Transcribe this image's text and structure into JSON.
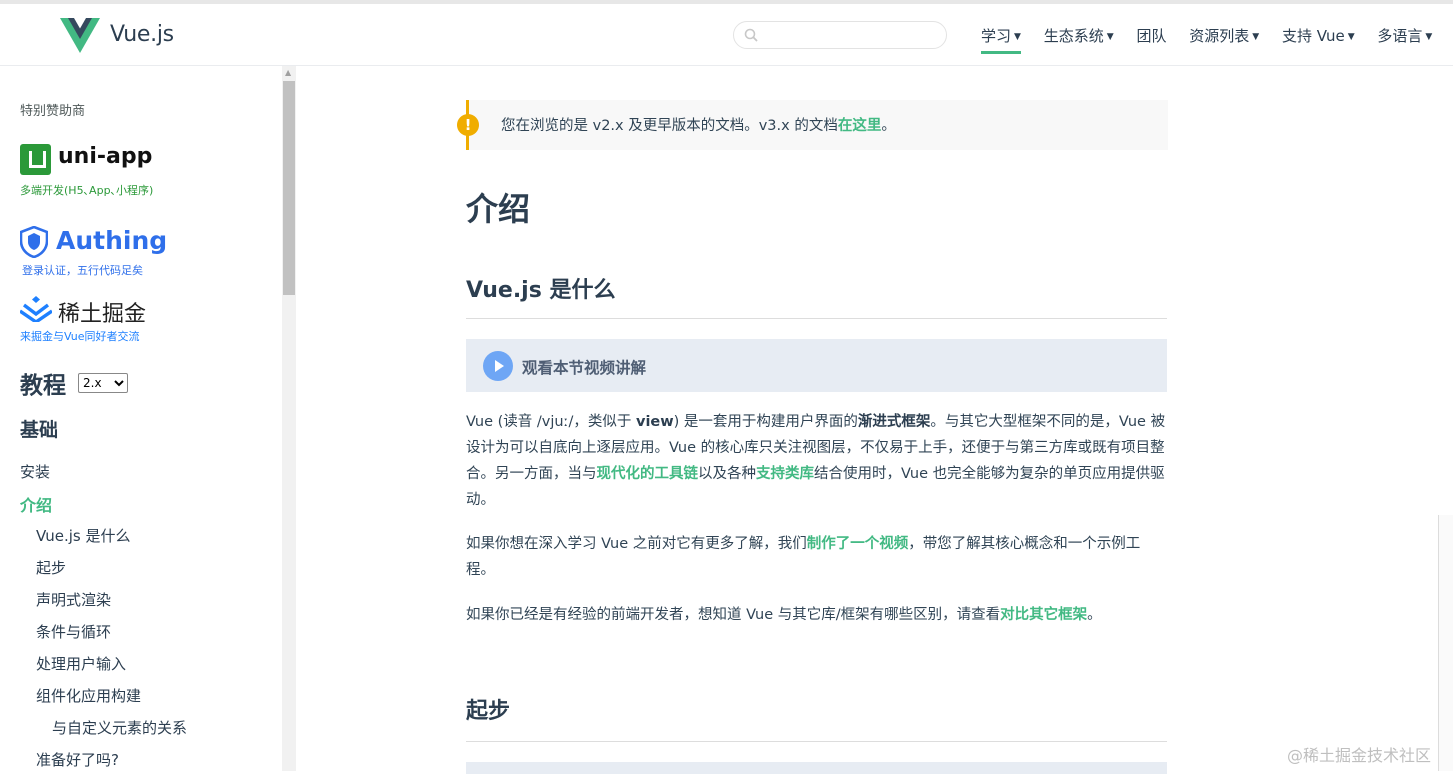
{
  "header": {
    "brand": "Vue.js",
    "search": {
      "value": "",
      "placeholder": ""
    },
    "nav": [
      {
        "label": "学习",
        "caret": "▼"
      },
      {
        "label": "生态系统",
        "caret": "▼"
      },
      {
        "label": "团队",
        "caret": ""
      },
      {
        "label": "资源列表",
        "caret": "▼"
      },
      {
        "label": "支持 Vue",
        "caret": "▼"
      },
      {
        "label": "多语言",
        "caret": "▼"
      }
    ]
  },
  "sidebar": {
    "sponsor_label": "特别赞助商",
    "sponsors": [
      {
        "name": "uni-app",
        "subtitle": "多端开发(H5､App､小程序)"
      },
      {
        "name": "Authing",
        "subtitle": "登录认证，五行代码足矣"
      },
      {
        "name": "稀土掘金",
        "subtitle": "来掘金与Vue同好者交流"
      }
    ],
    "tutorial_title": "教程",
    "version": {
      "selected": "2.x"
    },
    "section": "基础",
    "links": [
      "安装",
      "介绍",
      "Vue.js 是什么",
      "起步",
      "声明式渲染",
      "条件与循环",
      "处理用户输入",
      "组件化应用构建",
      "与自定义元素的关系",
      "准备好了吗?"
    ]
  },
  "content": {
    "notice": {
      "icon": "!",
      "text_before": "您在浏览的是 v2.x 及更早版本的文档。v3.x 的文档",
      "link": "在这里",
      "text_after": "。"
    },
    "title": "介绍",
    "section1_title": "Vue.js 是什么",
    "video_label": "观看本节视频讲解",
    "para1": {
      "t1": "Vue (读音 /vjuː/，类似于 ",
      "b1": "view",
      "t2": ") 是一套用于构建用户界面的",
      "b2": "渐进式框架",
      "t3": "。与其它大型框架不同的是，Vue 被设计为可以自底向上逐层应用。Vue 的核心库只关注视图层，不仅易于上手，还便于与第三方库或既有项目整合。另一方面，当与",
      "l1": "现代化的工具链",
      "t4": "以及各种",
      "l2": "支持类库",
      "t5": "结合使用时，Vue 也完全能够为复杂的单页应用提供驱动。"
    },
    "para2": {
      "t1": "如果你想在深入学习 Vue 之前对它有更多了解，我们",
      "l1": "制作了一个视频",
      "t2": "，带您了解其核心概念和一个示例工程。"
    },
    "para3": {
      "t1": "如果你已经是有经验的前端开发者，想知道 Vue 与其它库/框架有哪些区别，请查看",
      "l1": "对比其它框架",
      "t2": "。"
    },
    "section2_title": "起步"
  },
  "watermark": "@稀土掘金技术社区",
  "colors": {
    "accent": "#42b983",
    "text": "#2c3e50",
    "warning": "#f0ad00",
    "video_bg": "#e7ecf3"
  }
}
